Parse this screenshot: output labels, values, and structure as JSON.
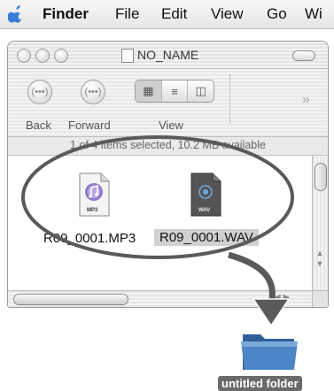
{
  "menubar": {
    "apple": "",
    "items": [
      "Finder",
      "File",
      "Edit",
      "View",
      "Go",
      "Wi"
    ]
  },
  "window": {
    "title": "NO_NAME",
    "toolbar": {
      "back_label": "Back",
      "forward_label": "Forward",
      "view_label": "View",
      "back_glyph": "(•••)",
      "forward_glyph": "(•••)",
      "overflow": "»"
    },
    "status": "1 of 4 items selected, 10.2 MB available",
    "files": [
      {
        "name": "R09_0001.MP3",
        "badge": "MP3",
        "selected": false
      },
      {
        "name": "R09_0001.WAV",
        "badge": "WAV",
        "selected": true
      }
    ]
  },
  "desktop": {
    "folder_label": "untitled folder"
  },
  "colors": {
    "annotation": "#5a5a5a",
    "folder": "#3f77b8",
    "selection": "#d0d0d0"
  }
}
